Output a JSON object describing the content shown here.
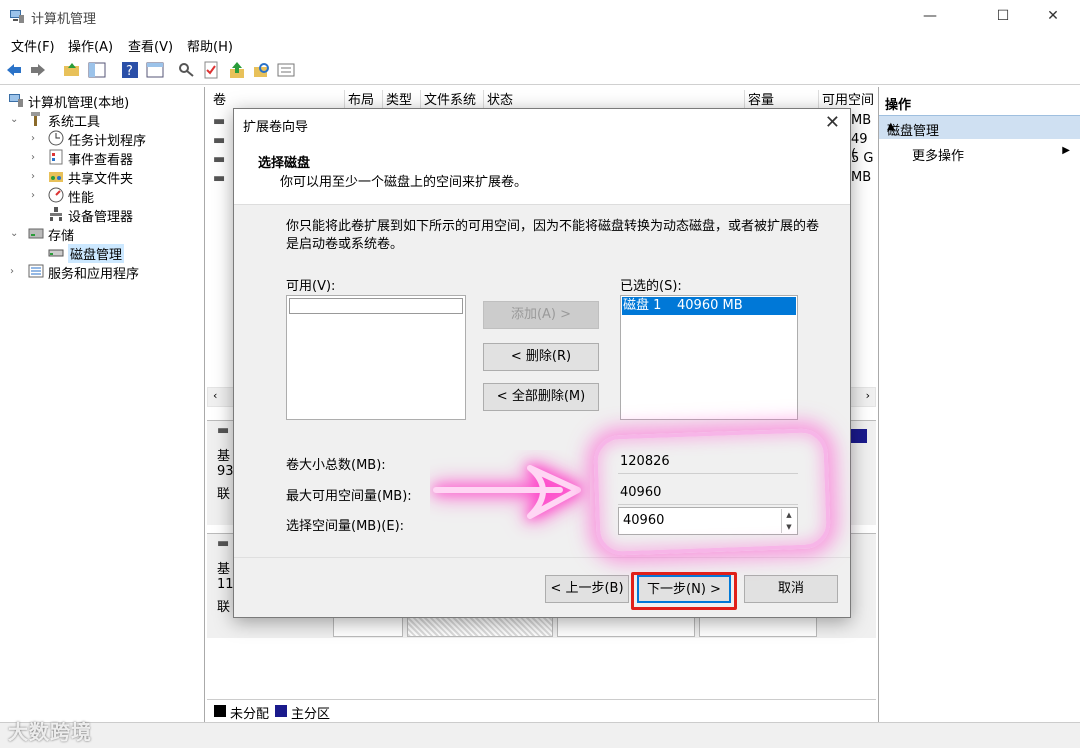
{
  "window": {
    "title": "计算机管理",
    "minimize": "—",
    "maximize": "☐",
    "close": "✕"
  },
  "menu": [
    "文件(F)",
    "操作(A)",
    "查看(V)",
    "帮助(H)"
  ],
  "tree": {
    "root": "计算机管理(本地)",
    "system_tools": "系统工具",
    "task_scheduler": "任务计划程序",
    "event_viewer": "事件查看器",
    "shared_folders": "共享文件夹",
    "performance": "性能",
    "device_manager": "设备管理器",
    "storage": "存储",
    "disk_management": "磁盘管理",
    "services_apps": "服务和应用程序"
  },
  "volumes": {
    "columns": [
      "卷",
      "布局",
      "类型",
      "文件系统",
      "状态",
      "容量",
      "可用空间"
    ],
    "partial_free": [
      "MB",
      "49 (",
      "5 G",
      "MB"
    ]
  },
  "disks": {
    "d1_lines": [
      "基",
      "93",
      "联"
    ],
    "d2_lines": [
      "基",
      "11",
      "联"
    ]
  },
  "legend": {
    "unallocated": "未分配",
    "primary": "主分区",
    "unallocated_color": "#000000",
    "primary_color": "#1a1a8c"
  },
  "actions": {
    "header": "操作",
    "section": "磁盘管理",
    "more": "更多操作"
  },
  "dialog": {
    "title": "扩展卷向导",
    "heading": "选择磁盘",
    "subheading": "你可以用至少一个磁盘上的空间来扩展卷。",
    "info": "你只能将此卷扩展到如下所示的可用空间，因为不能将磁盘转换为动态磁盘，或者被扩展的卷是启动卷或系统卷。",
    "available_label": "可用(V):",
    "selected_label": "已选的(S):",
    "selected_items": [
      {
        "disk": "磁盘 1",
        "size": "40960 MB"
      }
    ],
    "btn_add": "添加(A) >",
    "btn_remove": "< 删除(R)",
    "btn_remove_all": "< 全部删除(M)",
    "total_label": "卷大小总数(MB):",
    "total_value": "120826",
    "max_label": "最大可用空间量(MB):",
    "max_value": "40960",
    "select_label": "选择空间量(MB)(E):",
    "select_value": "40960",
    "btn_back": "< 上一步(B)",
    "btn_next": "下一步(N) >",
    "btn_cancel": "取消"
  },
  "watermark": "大数跨境",
  "colors": {
    "selection": "#0078d7",
    "highlight_glow": "#ff5ad2",
    "next_outline": "#e0201a"
  }
}
